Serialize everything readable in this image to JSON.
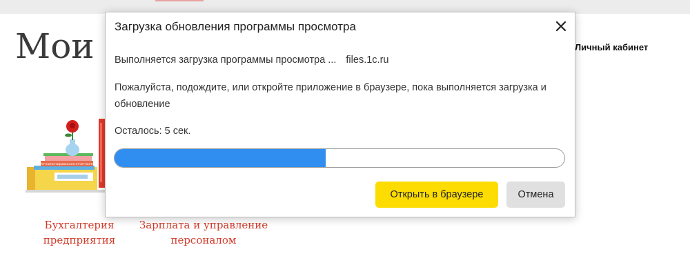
{
  "page": {
    "title": "Мои приложения",
    "account_link": "Личный кабинет",
    "products": [
      {
        "name": "Бухгалтерия предприятия"
      },
      {
        "name": "Зарплата и управление персоналом"
      }
    ],
    "book_label": "Регламентированная отчетность"
  },
  "dialog": {
    "title": "Загрузка обновления программы просмотра",
    "status_text": "Выполняется загрузка программы просмотра ...",
    "host": "files.1c.ru",
    "instruction": "Пожалуйста, подождите, или откройте приложение в браузере, пока выполняется загрузка и обновление",
    "remaining": "Осталось: 5 сек.",
    "progress_percent": 47,
    "open_button": "Открыть в браузере",
    "cancel_button": "Отмена"
  },
  "colors": {
    "accent_yellow": "#fddc02",
    "progress_blue": "#2f8ef0",
    "product_red": "#d23b2a"
  }
}
